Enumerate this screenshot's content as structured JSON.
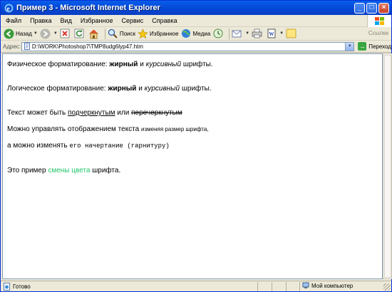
{
  "window": {
    "title": "Пример 3 - Microsoft Internet Explorer"
  },
  "menu": {
    "items": [
      "Файл",
      "Правка",
      "Вид",
      "Избранное",
      "Сервис",
      "Справка"
    ]
  },
  "toolbar": {
    "back_label": "Назад",
    "search_label": "Поиск",
    "favorites_label": "Избранное",
    "media_label": "Медиа",
    "links_label": "Ссылки"
  },
  "address": {
    "label": "Адрес:",
    "value": "D:\\WORK\\Photoshop7\\TMP8udg6lyp47.htm",
    "go_label": "Переход"
  },
  "content": {
    "line1": {
      "prefix": "Физическое форматирование: ",
      "bold": "жирный",
      "mid": " и ",
      "italic": "курсивный",
      "suffix": " шрифты."
    },
    "line2": {
      "prefix": "Логическое форматирование: ",
      "bold": "жирный",
      "mid": " и ",
      "italic": "курсивный",
      "suffix": " шрифты."
    },
    "line3": {
      "prefix": "Текст может быть ",
      "underline": "подчеркнутым",
      "mid": " или ",
      "strike": "перечеркнутым"
    },
    "line4": {
      "prefix": "Можно управлять отображением текста ",
      "small": "изменяя размер шрифта,"
    },
    "line5": {
      "prefix": "а можно изменять ",
      "mono": "его начертание (гарнитуру)"
    },
    "line6": {
      "prefix": "Это пример ",
      "colored": "смены цвета",
      "suffix": " шрифта."
    },
    "colored_text_color": "#24c66a"
  },
  "status": {
    "left": "Готово",
    "zone": "Мой компьютер"
  }
}
